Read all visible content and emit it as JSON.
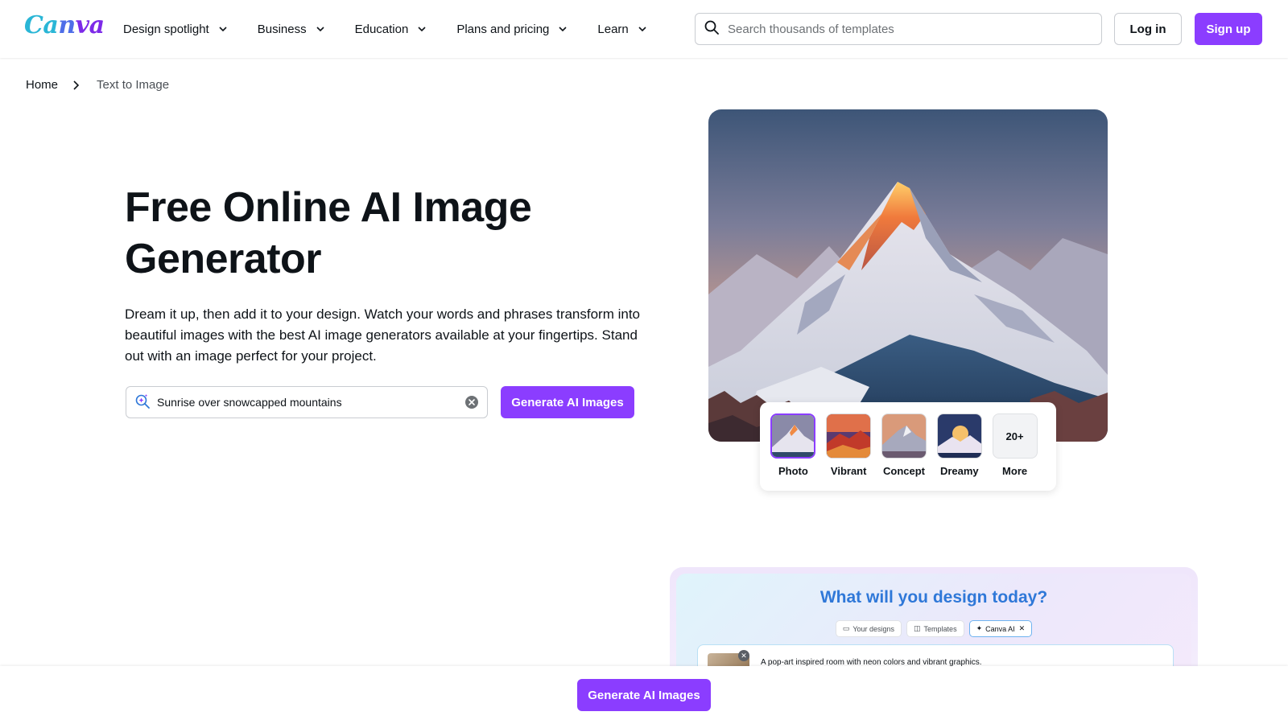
{
  "header": {
    "logo": "Canva",
    "nav": [
      {
        "label": "Design spotlight"
      },
      {
        "label": "Business"
      },
      {
        "label": "Education"
      },
      {
        "label": "Plans and pricing"
      },
      {
        "label": "Learn"
      }
    ],
    "search": {
      "placeholder": "Search thousands of templates",
      "value": ""
    },
    "login_label": "Log in",
    "signup_label": "Sign up"
  },
  "breadcrumb": {
    "home": "Home",
    "current": "Text to Image"
  },
  "hero": {
    "title": "Free Online AI Image Generator",
    "description": "Dream it up, then add it to your design. Watch your words and phrases transform into beautiful images with the best AI image generators available at your fingertips. Stand out with an image perfect for your project.",
    "prompt_value": "Sunrise over snowcapped mountains",
    "generate_label": "Generate AI Images"
  },
  "styles": {
    "selected": "Photo",
    "options": [
      {
        "label": "Photo"
      },
      {
        "label": "Vibrant"
      },
      {
        "label": "Concept"
      },
      {
        "label": "Dreamy"
      }
    ],
    "more_count": "20+",
    "more_label": "More"
  },
  "preview": {
    "title": "What will you design today?",
    "tabs": [
      {
        "label": "Your designs"
      },
      {
        "label": "Templates"
      },
      {
        "label": "Canva AI"
      }
    ],
    "prompt_text": "A pop-art inspired room with neon colors and vibrant graphics."
  },
  "sticky": {
    "generate_label": "Generate AI Images"
  },
  "colors": {
    "accent": "#8b3dff",
    "text": "#0e1318",
    "border": "#c9ccd1"
  }
}
